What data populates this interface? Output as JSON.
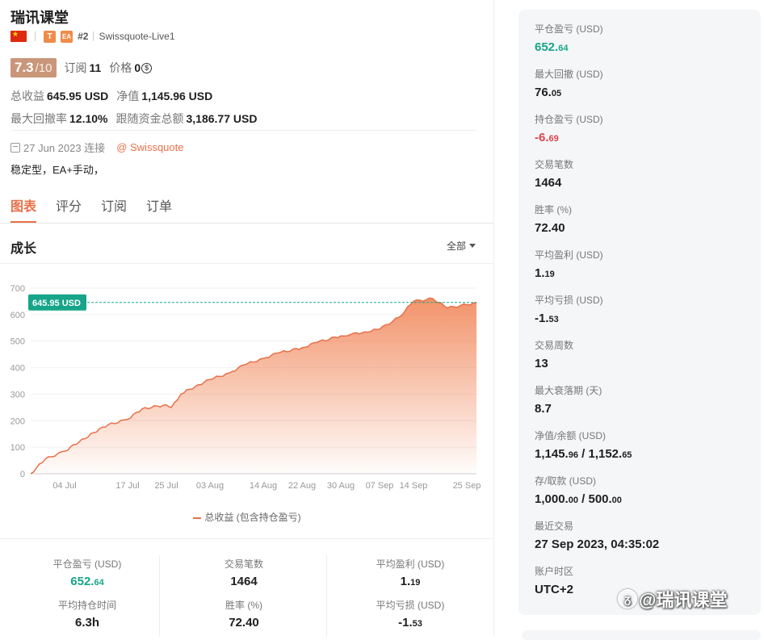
{
  "profile": {
    "title": "瑞讯课堂",
    "rank": "#2",
    "server": "Swissquote-Live1",
    "badge_t": "T",
    "badge_ea": "EA",
    "rating_score": "7.3",
    "rating_max": "/10",
    "subscriptions_label": "订阅",
    "subscriptions_value": "11",
    "price_label": "价格",
    "price_value": "0",
    "total_profit_label": "总收益",
    "total_profit_value": "645.95 USD",
    "equity_label": "净值",
    "equity_value": "1,145.96 USD",
    "max_drawdown_label": "最大回撤率",
    "max_drawdown_value": "12.10%",
    "follow_funds_label": "跟随资金总额",
    "follow_funds_value": "3,186.77 USD",
    "connected_text": "27 Jun 2023 连接",
    "broker": "@ Swissquote",
    "description": "稳定型，EA+手动，"
  },
  "tabs": [
    "图表",
    "评分",
    "订阅",
    "订单"
  ],
  "growth": {
    "title": "成长",
    "filter": "全部",
    "current_label": "645.95 USD",
    "legend": "总收益 (包含持仓盈亏)"
  },
  "chart_data": {
    "type": "area",
    "title": "",
    "series": [
      {
        "name": "总收益 (包含持仓盈亏)",
        "values": []
      }
    ],
    "x": [
      "27 Jun",
      "30 Jun",
      "04 Jul",
      "07 Jul",
      "10 Jul",
      "13 Jul",
      "17 Jul",
      "20 Jul",
      "25 Jul",
      "26 Jul",
      "28 Jul",
      "31 Jul",
      "03 Aug",
      "07 Aug",
      "10 Aug",
      "14 Aug",
      "17 Aug",
      "22 Aug",
      "25 Aug",
      "30 Aug",
      "01 Sep",
      "04 Sep",
      "07 Sep",
      "11 Sep",
      "14 Sep",
      "18 Sep",
      "21 Sep",
      "25 Sep",
      "27 Sep"
    ],
    "y": [
      0,
      55,
      85,
      120,
      155,
      185,
      205,
      245,
      260,
      250,
      300,
      330,
      355,
      380,
      410,
      435,
      455,
      475,
      495,
      520,
      525,
      535,
      545,
      590,
      650,
      660,
      625,
      638,
      646
    ],
    "xticks": [
      "04 Jul",
      "17 Jul",
      "25 Jul",
      "03 Aug",
      "14 Aug",
      "22 Aug",
      "30 Aug",
      "07 Sep",
      "14 Sep",
      "25 Sep"
    ],
    "yticks": [
      0,
      100,
      200,
      300,
      400,
      500,
      600,
      700
    ],
    "ylim": [
      0,
      700
    ],
    "reference_line": 645.95,
    "color": "#e8704a"
  },
  "bottom_stats": [
    {
      "label": "平仓盈亏 (USD)",
      "int": "652.",
      "dec": "64",
      "color": "green"
    },
    {
      "label": "交易笔数",
      "int": "1464",
      "dec": "",
      "color": ""
    },
    {
      "label": "平均盈利 (USD)",
      "int": "1.",
      "dec": "19",
      "color": ""
    },
    {
      "label": "平均持仓时间",
      "int": "6.3h",
      "dec": "",
      "color": ""
    },
    {
      "label": "胜率 (%)",
      "int": "72.40",
      "dec": "",
      "color": ""
    },
    {
      "label": "平均亏损 (USD)",
      "int": "-1.",
      "dec": "53",
      "color": ""
    }
  ],
  "side_stats": [
    {
      "label": "平仓盈亏 (USD)",
      "int": "652.",
      "dec": "64",
      "color": "green"
    },
    {
      "label": "最大回撤 (USD)",
      "int": "76.",
      "dec": "05",
      "color": ""
    },
    {
      "label": "持仓盈亏 (USD)",
      "int": "-6.",
      "dec": "69",
      "color": "red"
    },
    {
      "label": "交易笔数",
      "int": "1464",
      "dec": "",
      "color": ""
    },
    {
      "label": "胜率 (%)",
      "int": "72.40",
      "dec": "",
      "color": ""
    },
    {
      "label": "平均盈利 (USD)",
      "int": "1.",
      "dec": "19",
      "color": ""
    },
    {
      "label": "平均亏损 (USD)",
      "int": "-1.",
      "dec": "53",
      "color": ""
    },
    {
      "label": "交易周数",
      "int": "13",
      "dec": "",
      "color": ""
    },
    {
      "label": "最大衰落期 (天)",
      "int": "8.7",
      "dec": "",
      "color": ""
    },
    {
      "label": "净值/余额 (USD)",
      "int": "1,145.",
      "dec": "96",
      "int2": " / 1,152.",
      "dec2": "65",
      "color": ""
    },
    {
      "label": "存/取款 (USD)",
      "int": "1,000.",
      "dec": "00",
      "int2": " / 500.",
      "dec2": "00",
      "color": ""
    },
    {
      "label": "最近交易",
      "int": "27 Sep 2023, 04:35:02",
      "dec": "",
      "color": ""
    },
    {
      "label": "账户时区",
      "int": "UTC+2",
      "dec": "",
      "color": ""
    }
  ],
  "watermark": "@瑞讯课堂"
}
